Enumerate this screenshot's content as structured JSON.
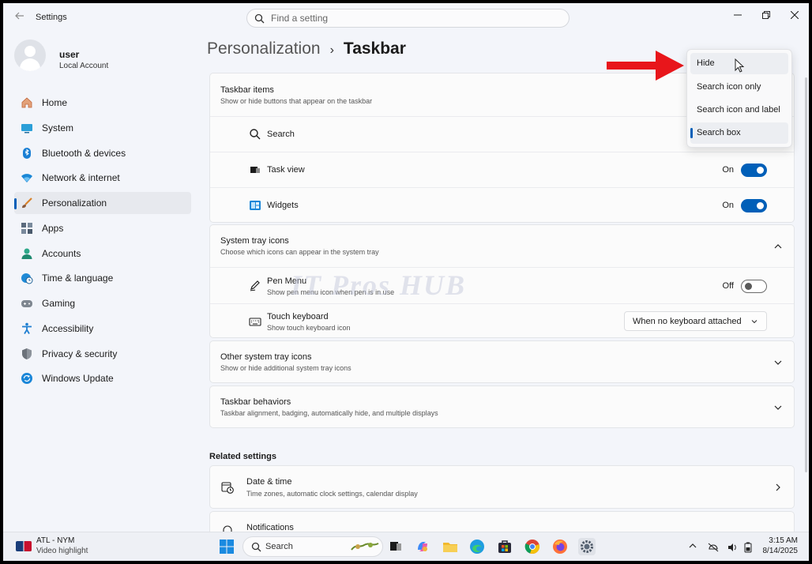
{
  "window": {
    "title": "Settings",
    "search_placeholder": "Find a setting",
    "controls": [
      "minimize",
      "maximize",
      "close"
    ]
  },
  "profile": {
    "name": "user",
    "account_type": "Local Account"
  },
  "sidebar": {
    "items": [
      {
        "label": "Home",
        "icon": "home-icon"
      },
      {
        "label": "System",
        "icon": "system-icon"
      },
      {
        "label": "Bluetooth & devices",
        "icon": "bluetooth-icon"
      },
      {
        "label": "Network & internet",
        "icon": "wifi-icon"
      },
      {
        "label": "Personalization",
        "icon": "brush-icon",
        "active": true
      },
      {
        "label": "Apps",
        "icon": "apps-icon"
      },
      {
        "label": "Accounts",
        "icon": "accounts-icon"
      },
      {
        "label": "Time & language",
        "icon": "globe-clock-icon"
      },
      {
        "label": "Gaming",
        "icon": "gamepad-icon"
      },
      {
        "label": "Accessibility",
        "icon": "accessibility-icon"
      },
      {
        "label": "Privacy & security",
        "icon": "shield-icon"
      },
      {
        "label": "Windows Update",
        "icon": "update-icon"
      }
    ]
  },
  "breadcrumb": {
    "parent": "Personalization",
    "separator": "›",
    "current": "Taskbar"
  },
  "taskbar_items": {
    "title": "Taskbar items",
    "subtitle": "Show or hide buttons that appear on the taskbar",
    "search_label": "Search",
    "task_view_label": "Task view",
    "task_view_state": "On",
    "widgets_label": "Widgets",
    "widgets_state": "On"
  },
  "system_tray": {
    "title": "System tray icons",
    "subtitle": "Choose which icons can appear in the system tray",
    "pen_menu_label": "Pen Menu",
    "pen_menu_sub": "Show pen menu icon when pen is in use",
    "pen_menu_state": "Off",
    "touch_keyboard_label": "Touch keyboard",
    "touch_keyboard_sub": "Show touch keyboard icon",
    "touch_keyboard_value": "When no keyboard attached"
  },
  "other_tray": {
    "title": "Other system tray icons",
    "subtitle": "Show or hide additional system tray icons"
  },
  "behaviors": {
    "title": "Taskbar behaviors",
    "subtitle": "Taskbar alignment, badging, automatically hide, and multiple displays"
  },
  "related": {
    "title": "Related settings",
    "date_time_label": "Date & time",
    "date_time_sub": "Time zones, automatic clock settings, calendar display",
    "notifications_label": "Notifications"
  },
  "search_dropdown": {
    "options": [
      "Hide",
      "Search icon only",
      "Search icon and label",
      "Search box"
    ],
    "hovered": "Hide",
    "selected": "Search box"
  },
  "watermark": "IT Pros HUB",
  "os_taskbar": {
    "news_title": "ATL - NYM",
    "news_sub": "Video highlight",
    "search_label": "Search",
    "time": "3:15 AM",
    "date": "8/14/2025"
  },
  "colors": {
    "accent": "#005fb8",
    "arrow": "#e8161b",
    "window_bg": "#f3f5fa",
    "card_bg": "#fbfbfb"
  }
}
